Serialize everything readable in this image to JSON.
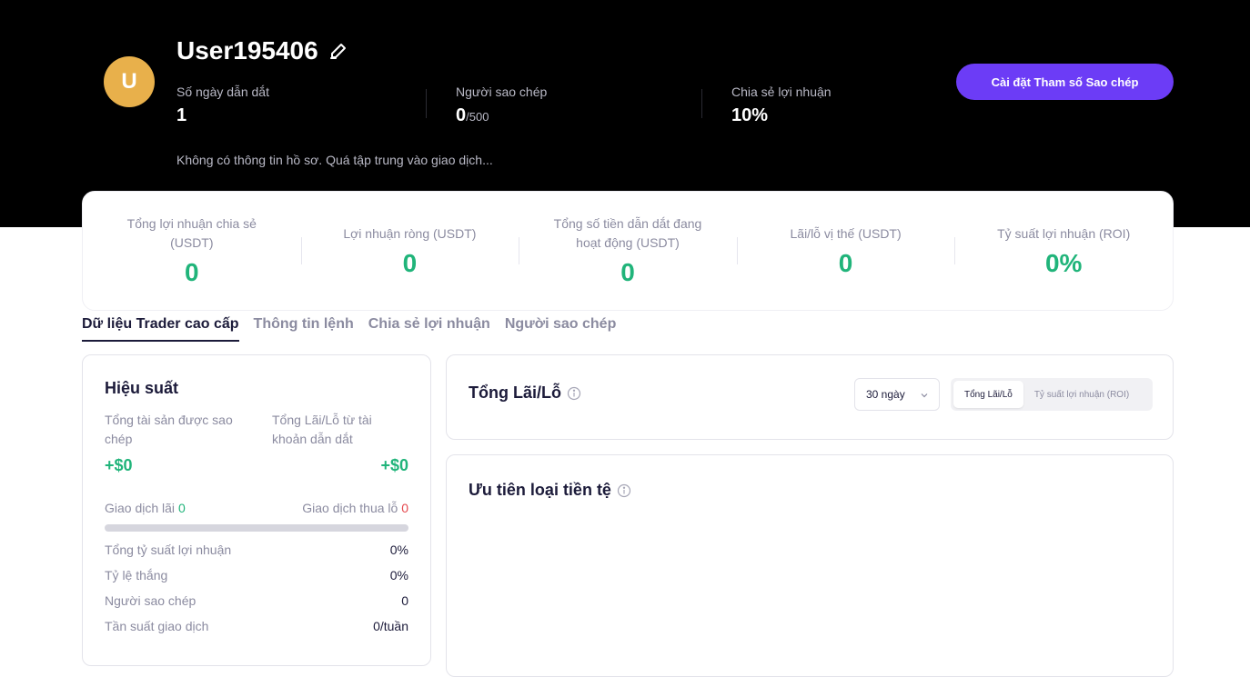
{
  "profile": {
    "avatar_letter": "U",
    "username": "User195406",
    "bio": "Không có thông tin hồ sơ. Quá tập trung vào giao dịch...",
    "stats": [
      {
        "label": "Số ngày dẫn dắt",
        "value": "1",
        "sub": ""
      },
      {
        "label": "Người sao chép",
        "value": "0",
        "sub": "/500"
      },
      {
        "label": "Chia sẻ lợi nhuận",
        "value": "10%",
        "sub": ""
      }
    ],
    "cta_label": "Cài đặt Tham số Sao chép"
  },
  "summary": [
    {
      "label": "Tổng lợi nhuận chia sẻ (USDT)",
      "value": "0"
    },
    {
      "label": "Lợi nhuận ròng (USDT)",
      "value": "0"
    },
    {
      "label": "Tổng số tiền dẫn dắt đang hoạt động (USDT)",
      "value": "0"
    },
    {
      "label": "Lãi/lỗ vị thế (USDT)",
      "value": "0"
    },
    {
      "label": "Tỷ suất lợi nhuận (ROI)",
      "value": "0%"
    }
  ],
  "tabs": [
    "Dữ liệu Trader cao cấp",
    "Thông tin lệnh",
    "Chia sẻ lợi nhuận",
    "Người sao chép"
  ],
  "performance": {
    "title": "Hiệu suất",
    "copied_assets_label": "Tổng tài sản được sao chép",
    "copied_assets_value": "+$0",
    "lead_pnl_label": "Tổng Lãi/Lỗ từ tài khoản dẫn dắt",
    "lead_pnl_value": "+$0",
    "win_label": "Giao dịch lãi",
    "win_value": "0",
    "loss_label": "Giao dịch thua lỗ",
    "loss_value": "0",
    "metrics": [
      {
        "label": "Tổng tỷ suất lợi nhuận",
        "value": "0%"
      },
      {
        "label": "Tỷ lệ thắng",
        "value": "0%"
      },
      {
        "label": "Người sao chép",
        "value": "0"
      },
      {
        "label": "Tần suất giao dịch",
        "value": "0/tuần"
      }
    ]
  },
  "pnl_card": {
    "title": "Tổng Lãi/Lỗ",
    "period": "30 ngày",
    "toggle": [
      "Tổng Lãi/Lỗ",
      "Tỷ suất lợi nhuận (ROI)"
    ]
  },
  "currency_card": {
    "title": "Ưu tiên loại tiền tệ"
  },
  "colors": {
    "accent": "#6c3cf6",
    "positive": "#20b47a",
    "negative": "#e5484d",
    "avatar": "#e8b04b"
  }
}
